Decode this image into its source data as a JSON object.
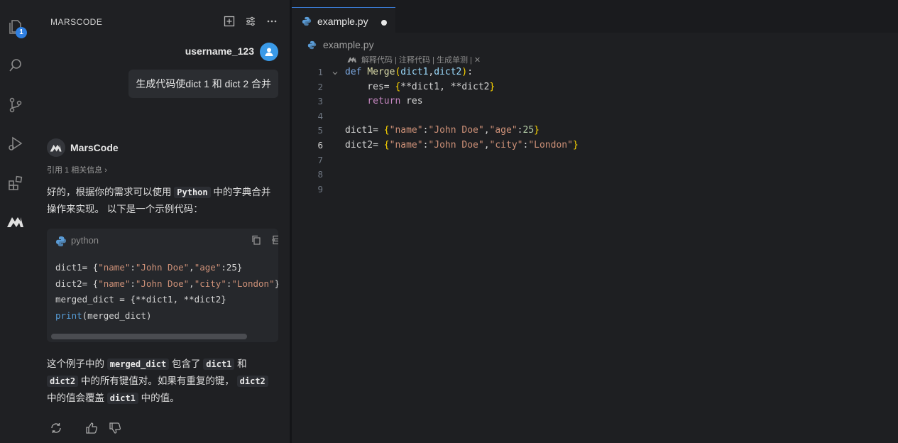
{
  "chat": {
    "title": "MARSCODE",
    "user": {
      "name": "username_123",
      "message": "生成代码使dict 1 和 dict 2 合并"
    },
    "bot": {
      "name": "MarsCode",
      "reference": "引用 1 相关信息 ›",
      "intro_parts": [
        "好的，根据你的需求可以使用 ",
        "Python",
        " 中的字典合并操作来实现。 以下是一个示例代码："
      ],
      "code_block": {
        "language": "python",
        "lines": [
          "dict1= {\"name\":\"John Doe\",\"age\":25}",
          "dict2= {\"name\":\"John Doe\",\"city\":\"London\"}",
          "merged_dict = {**dict1, **dict2}",
          "print(merged_dict)"
        ]
      },
      "outro_parts": [
        "这个例子中的 ",
        "merged_dict",
        " 包含了 ",
        "dict1",
        " 和 ",
        "dict2",
        " 中的所有键值对。如果有重复的键， ",
        "dict2",
        " 中的值会覆盖 ",
        "dict1",
        " 中的值。"
      ]
    },
    "badge_count": "1"
  },
  "editor": {
    "tab": "example.py",
    "breadcrumb": "example.py",
    "codelens": "解释代码 | 注释代码 | 生成单测 | ✕",
    "line_numbers": [
      "1",
      "2",
      "3",
      "4",
      "5",
      "6",
      "7",
      "8",
      "9"
    ],
    "current_line": 6,
    "code_lines": [
      "def Merge(dict1,dict2):",
      "    res= {**dict1, **dict2}",
      "    return res",
      "",
      "dict1= {\"name\":\"John Doe\",\"age\":25}",
      "dict2= {\"name\":\"John Doe\",\"city\":\"London\"}",
      "",
      "",
      ""
    ]
  },
  "icons": [
    "explorer-icon",
    "search-icon",
    "source-control-icon",
    "run-debug-icon",
    "extensions-icon",
    "marscode-icon",
    "new-chat-icon",
    "settings-icon",
    "more-icon",
    "copy-icon",
    "insert-icon",
    "new-file-icon",
    "regenerate-icon",
    "thumbs-up-icon",
    "thumbs-down-icon",
    "python-icon",
    "fold-chevron-icon"
  ],
  "colors": {
    "accent": "#2f7fe0",
    "avatar": "#3a9ae8"
  }
}
